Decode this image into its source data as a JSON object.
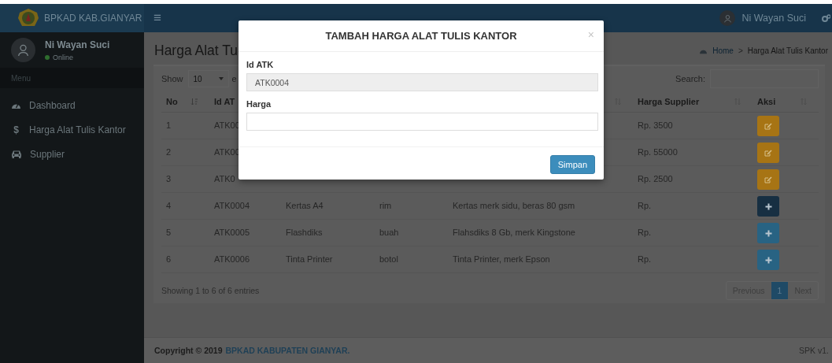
{
  "brand": {
    "title": "BPKAD KAB.GIANYAR"
  },
  "topbar": {
    "menu_glyph": "≡",
    "user_name": "Ni Wayan Suci"
  },
  "sidebar": {
    "user": {
      "name": "Ni Wayan Suci",
      "status": "Online"
    },
    "menu_header": "Menu",
    "items": [
      {
        "label": "Dashboard"
      },
      {
        "glyph": "$",
        "label": "Harga Alat Tulis Kantor"
      },
      {
        "label": "Supplier"
      }
    ]
  },
  "page": {
    "title": "Harga Alat Tu",
    "breadcrumb": [
      {
        "label": "Home"
      },
      {
        "label": "Harga Alat Tulis Kantor"
      }
    ],
    "breadcrumb_separator": ">"
  },
  "table": {
    "show_label": "Show",
    "page_size": "10",
    "entries_label": "e",
    "search_label": "Search:",
    "columns": [
      {
        "label": "No",
        "sorted": true
      },
      {
        "label": "Id AT"
      },
      {},
      {},
      {
        "sorted": false
      },
      {
        "label": "Harga Supplier",
        "sorted": false
      },
      {
        "label": "Aksi",
        "sorted": false
      }
    ],
    "rows": [
      {
        "no": "1",
        "id": "ATK00",
        "price": "Rp. 3500",
        "kind": "edit",
        "focused": false
      },
      {
        "no": "2",
        "id": "ATK00",
        "price": "Rp. 55000",
        "kind": "edit",
        "focused": false
      },
      {
        "no": "3",
        "id": "ATK0",
        "price": "Rp. 2500",
        "kind": "edit",
        "focused": false
      },
      {
        "no": "4",
        "id": "ATK0004",
        "name": "Kertas A4",
        "unit": "rim",
        "description": "Kertas merk sidu, beras 80 gsm",
        "price": "Rp.",
        "kind": "add",
        "focused": true
      },
      {
        "no": "5",
        "id": "ATK0005",
        "name": "Flashdiks",
        "unit": "buah",
        "description": "Flahsdiks 8 Gb, merk Kingstone",
        "price": "Rp.",
        "kind": "add",
        "focused": false
      },
      {
        "no": "6",
        "id": "ATK0006",
        "name": "Tinta Printer",
        "unit": "botol",
        "description": "Tinta Printer, merk Epson",
        "price": "Rp.",
        "kind": "add",
        "focused": false
      }
    ],
    "info": "Showing 1 to 6 of 6 entries",
    "pagination": {
      "previous": "Previous",
      "pages": [
        {
          "label": "1",
          "selected": true
        }
      ],
      "next": "Next"
    }
  },
  "footer": {
    "copyright": "Copyright © 2019",
    "link": "BPKAD KABUPATEN GIANYAR.",
    "version": "SPK v1."
  },
  "modal": {
    "title": "TAMBAH HARGA ALAT TULIS KANTOR",
    "close": "×",
    "fields": [
      {
        "label": "Id ATK",
        "value": "ATK0004",
        "readonly": true
      },
      {
        "label": "Harga",
        "readonly": false
      }
    ],
    "submit": "Simpan"
  }
}
